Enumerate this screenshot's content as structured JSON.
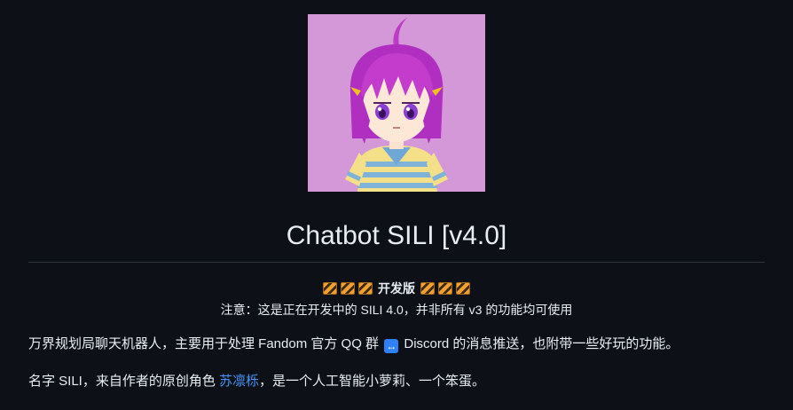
{
  "header": {
    "title": "Chatbot SILI [v4.0]"
  },
  "banner": {
    "dev_label": "开发版",
    "notice": "注意：这是正在开发中的 SILI 4.0，并非所有 v3 的功能均可使用"
  },
  "intro": {
    "p1_before": "万界规划局聊天机器人，主要用于处理 Fandom 官方 QQ 群 ",
    "p1_icon": "↔",
    "p1_after": " Discord 的消息推送，也附带一些好玩的功能。",
    "p2_before": "名字 SILI，来自作者的原创角色 ",
    "p2_link": "苏凛栎",
    "p2_after": "，是一个人工智能小萝莉、一个笨蛋。"
  },
  "colors": {
    "background": "#0d1117",
    "text": "#e6edf3",
    "link": "#4493f8",
    "avatar_bg": "#d498d8"
  },
  "icons": {
    "construction": "construction-icon",
    "left_right_arrow": "left-right-arrow-icon"
  }
}
